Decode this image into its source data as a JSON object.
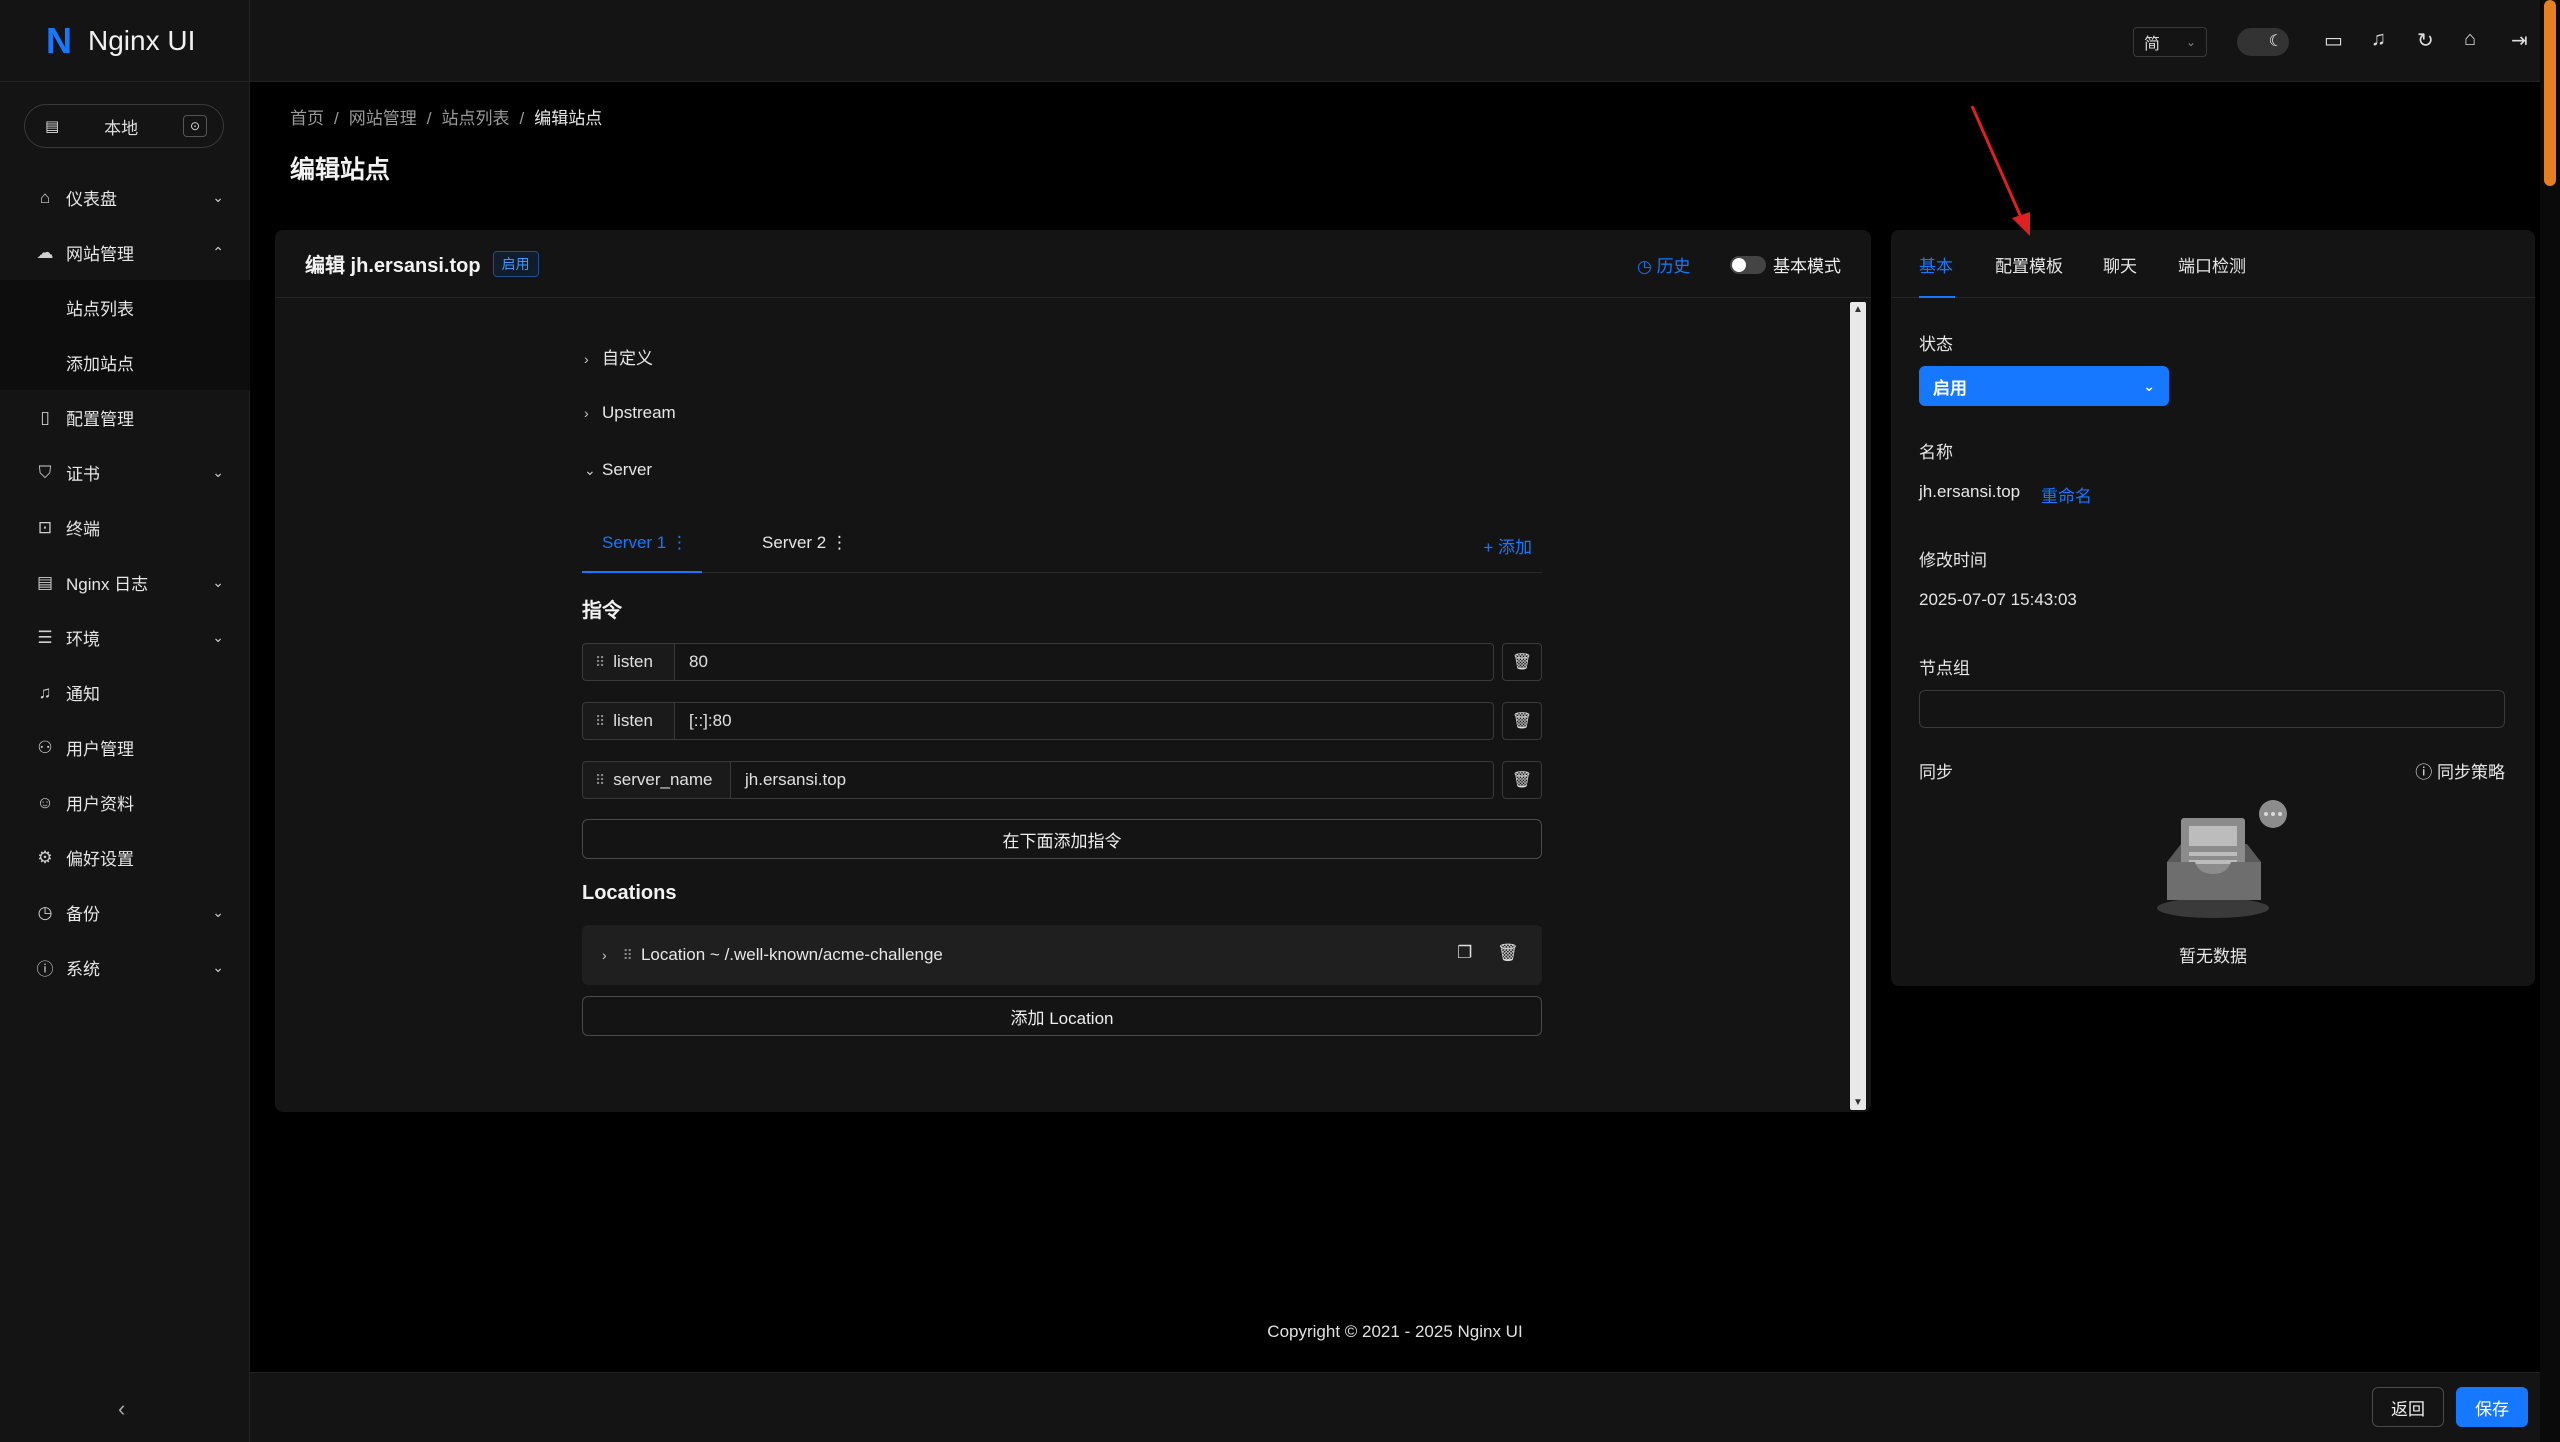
{
  "app": {
    "name": "Nginx UI",
    "logo_letter": "N"
  },
  "env": {
    "label": "本地"
  },
  "sidebar": {
    "items": [
      {
        "label": "仪表盘",
        "icon": "home-icon",
        "chevron": "down"
      },
      {
        "label": "网站管理",
        "icon": "cloud-icon",
        "chevron": "up"
      },
      {
        "label": "站点列表",
        "sub": true
      },
      {
        "label": "添加站点",
        "sub": true
      },
      {
        "label": "配置管理",
        "icon": "file-icon"
      },
      {
        "label": "证书",
        "icon": "shield-icon",
        "chevron": "down"
      },
      {
        "label": "终端",
        "icon": "terminal-icon"
      },
      {
        "label": "Nginx 日志",
        "icon": "log-icon",
        "chevron": "down"
      },
      {
        "label": "环境",
        "icon": "database-icon",
        "chevron": "down"
      },
      {
        "label": "通知",
        "icon": "bell-icon"
      },
      {
        "label": "用户管理",
        "icon": "users-icon"
      },
      {
        "label": "用户资料",
        "icon": "user-icon"
      },
      {
        "label": "偏好设置",
        "icon": "gear-icon"
      },
      {
        "label": "备份",
        "icon": "clock-icon",
        "chevron": "down"
      },
      {
        "label": "系统",
        "icon": "info-icon",
        "chevron": "down"
      }
    ]
  },
  "topbar": {
    "lang": "简"
  },
  "breadcrumb": {
    "home": "首页",
    "site_mgmt": "网站管理",
    "site_list": "站点列表",
    "current": "编辑站点"
  },
  "page_title": "编辑站点",
  "editor": {
    "title": "编辑 jh.ersansi.top",
    "badge": "启用",
    "history": "历史",
    "basic_mode": "基本模式",
    "sections": {
      "custom": "自定义",
      "upstream": "Upstream",
      "server": "Server"
    },
    "tabs": {
      "server1": "Server 1",
      "server2": "Server 2",
      "add": "添加"
    },
    "directives_heading": "指令",
    "directives": [
      {
        "name": "listen",
        "value": "80"
      },
      {
        "name": "listen",
        "value": "[::]:80"
      },
      {
        "name": "server_name",
        "value": "jh.ersansi.top"
      }
    ],
    "add_directive": "在下面添加指令",
    "locations_heading": "Locations",
    "location": "Location ~ /.well-known/acme-challenge",
    "add_location": "添加 Location"
  },
  "side": {
    "tabs": {
      "basic": "基本",
      "template": "配置模板",
      "chat": "聊天",
      "port": "端口检测"
    },
    "status_label": "状态",
    "status_value": "启用",
    "name_label": "名称",
    "name_value": "jh.ersansi.top",
    "rename": "重命名",
    "modified_label": "修改时间",
    "modified_value": "2025-07-07 15:43:03",
    "node_group_label": "节点组",
    "sync_label": "同步",
    "sync_policy": "同步策略",
    "empty": "暂无数据"
  },
  "footer": {
    "copyright": "Copyright © 2021 - 2025 Nginx UI"
  },
  "actions": {
    "back": "返回",
    "save": "保存"
  },
  "colors": {
    "accent": "#1677ff",
    "background": "#000000",
    "panel": "#141414",
    "annotation_arrow": "#e02020"
  }
}
